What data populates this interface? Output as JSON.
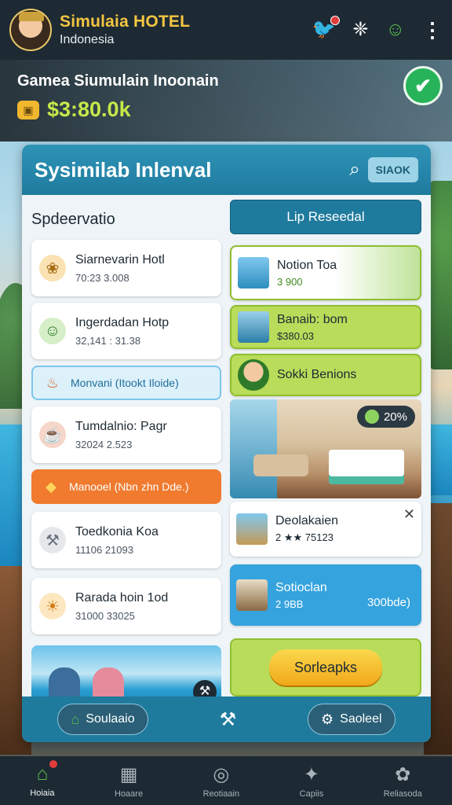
{
  "header": {
    "title": "Simulaia HOTEL",
    "subtitle": "Indonesia"
  },
  "stats": {
    "title": "Gamea Siumulain Inoonain",
    "money": "$3:80.0k"
  },
  "panel": {
    "title": "Sysimilab Inlenval",
    "stock_label": "SIAOK",
    "section_label": "Spdeervatio",
    "reserve_label": "Lip Reseedal",
    "left_items": [
      {
        "title": "Siarnevarin Hotl",
        "sub": "70:23  3.008"
      },
      {
        "title": "Ingerdadan Hotp",
        "sub": "32,141 : 31.38"
      },
      {
        "tag": "Monvani (Itookt Iloide)"
      },
      {
        "title": "Tumdalnio: Pagr",
        "sub": "32024  2.523"
      },
      {
        "tag": "Manooel (Nbn zhn Dde.)"
      },
      {
        "title": "Toedkonia Koa",
        "sub": "11106  21093"
      },
      {
        "title": "Rarada hoin 1od",
        "sub": "31000  33025"
      }
    ],
    "right_items": {
      "card1": {
        "title": "Notion Toa",
        "sub": "3 900"
      },
      "card2": {
        "title": "Banaib: bom",
        "sub": "$380.03"
      },
      "card3": {
        "title": "Sokki Benions"
      },
      "room_badge": "20%",
      "card4": {
        "title": "Deolakaien",
        "sub": "2 ★★  75123"
      },
      "card5": {
        "title": "Sotioclan",
        "sub": "2 9BB",
        "extra": "300bde)"
      },
      "cta": "Sorleapks"
    },
    "footer": {
      "left": "Soulaaio",
      "right": "Saoleel"
    }
  },
  "bottom_nav": [
    {
      "label": "Hoiaia",
      "icon": "home-icon"
    },
    {
      "label": "Hoaare",
      "icon": "building-icon"
    },
    {
      "label": "Reotiaain",
      "icon": "record-icon"
    },
    {
      "label": "Capiis",
      "icon": "group-icon"
    },
    {
      "label": "Reliasoda",
      "icon": "flower-icon"
    }
  ],
  "colors": {
    "accent": "#1f7b9e",
    "brand": "#f4c542",
    "money": "#c6e84a",
    "success": "#27b35a",
    "card_green": "#b9dc5a",
    "tag_orange": "#f07a2e"
  }
}
